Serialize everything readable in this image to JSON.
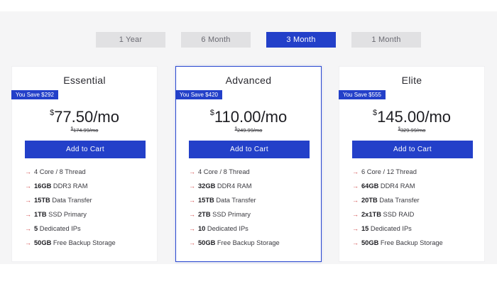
{
  "billing_tabs": [
    {
      "label": "1 Year",
      "active": false
    },
    {
      "label": "6 Month",
      "active": false
    },
    {
      "label": "3 Month",
      "active": true
    },
    {
      "label": "1 Month",
      "active": false
    }
  ],
  "plans": [
    {
      "name": "Essential",
      "badge": "You Save $292",
      "currency": "$",
      "price": "77.50",
      "period": "/mo",
      "old_currency": "$",
      "old_price": "174.99/mo",
      "cta": "Add to Cart",
      "features": [
        {
          "strong": "",
          "text": "4 Core / 8 Thread"
        },
        {
          "strong": "16GB",
          "text": " DDR3 RAM"
        },
        {
          "strong": "15TB",
          "text": " Data Transfer"
        },
        {
          "strong": "1TB",
          "text": " SSD Primary"
        },
        {
          "strong": "5",
          "text": " Dedicated IPs"
        },
        {
          "strong": "50GB",
          "text": " Free Backup Storage"
        }
      ]
    },
    {
      "name": "Advanced",
      "badge": "You Save $420",
      "currency": "$",
      "price": "110.00",
      "period": "/mo",
      "old_currency": "$",
      "old_price": "249.99/mo",
      "cta": "Add to Cart",
      "features": [
        {
          "strong": "",
          "text": "4 Core / 8 Thread"
        },
        {
          "strong": "32GB",
          "text": " DDR4 RAM"
        },
        {
          "strong": "15TB",
          "text": " Data Transfer"
        },
        {
          "strong": "2TB",
          "text": " SSD Primary"
        },
        {
          "strong": "10",
          "text": " Dedicated IPs"
        },
        {
          "strong": "50GB",
          "text": " Free Backup Storage"
        }
      ]
    },
    {
      "name": "Elite",
      "badge": "You Save $555",
      "currency": "$",
      "price": "145.00",
      "period": "/mo",
      "old_currency": "$",
      "old_price": "329.99/mo",
      "cta": "Add to Cart",
      "features": [
        {
          "strong": "",
          "text": "6 Core / 12 Thread"
        },
        {
          "strong": "64GB",
          "text": " DDR4 RAM"
        },
        {
          "strong": "20TB",
          "text": " Data Transfer"
        },
        {
          "strong": "2x1TB",
          "text": " SSD RAID"
        },
        {
          "strong": "15",
          "text": " Dedicated IPs"
        },
        {
          "strong": "50GB",
          "text": " Free Backup Storage"
        }
      ]
    }
  ],
  "colors": {
    "accent": "#2340c9",
    "arrow": "#d24b4b",
    "tab_inactive": "#e1e1e3"
  },
  "icons": {
    "feature_bullet": "arrow-right-icon"
  }
}
